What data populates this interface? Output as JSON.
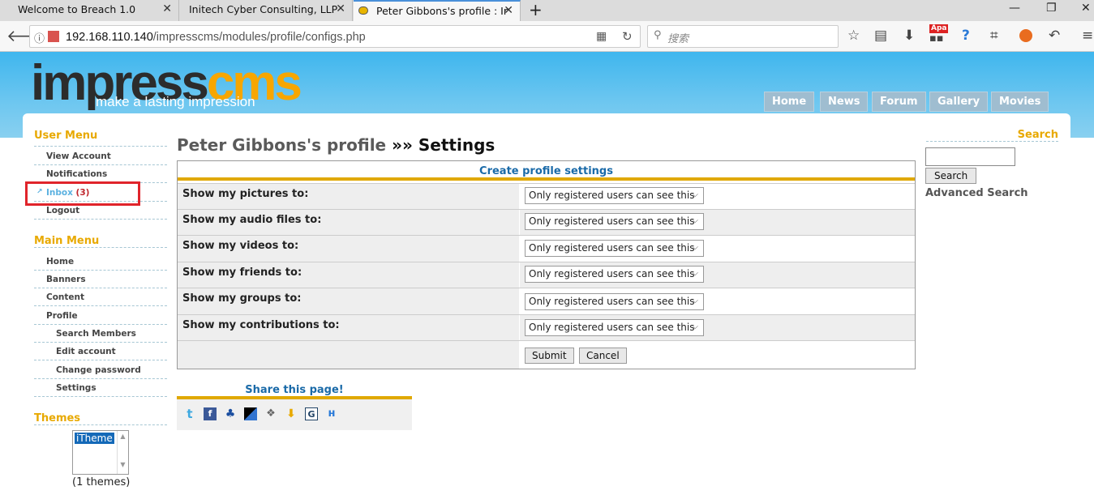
{
  "browser": {
    "tabs": [
      {
        "label": "Welcome to Breach 1.0"
      },
      {
        "label": "Initech Cyber Consulting, LLP"
      },
      {
        "label": "Peter Gibbons's profile : Ir"
      }
    ],
    "url_host": "192.168.110.140",
    "url_path": "/impresscms/modules/profile/configs.php",
    "search_placeholder": "搜索",
    "addon_badge": "Apa"
  },
  "site": {
    "logo_part1": "impress",
    "logo_part2": "cms",
    "tagline": "make a lasting impression",
    "nav": [
      "Home",
      "News",
      "Forum",
      "Gallery",
      "Movies"
    ]
  },
  "user_menu": {
    "title": "User Menu",
    "items": [
      "View Account",
      "Notifications",
      "Inbox",
      "Logout"
    ],
    "inbox_count": "(3)"
  },
  "main_menu": {
    "title": "Main Menu",
    "items": [
      "Home",
      "Banners",
      "Content",
      "Profile"
    ],
    "sub_items": [
      "Search Members",
      "Edit account",
      "Change password",
      "Settings"
    ]
  },
  "themes": {
    "title": "Themes",
    "option": "iTheme",
    "count": "(1 themes)"
  },
  "page": {
    "title_part1": "Peter Gibbons's profile",
    "separator": "»»",
    "title_part2": "Settings"
  },
  "form": {
    "caption": "Create profile settings",
    "rows": [
      {
        "label": "Show my pictures to:",
        "value": "Only registered users can see this"
      },
      {
        "label": "Show my audio files to:",
        "value": "Only registered users can see this"
      },
      {
        "label": "Show my videos to:",
        "value": "Only registered users can see this"
      },
      {
        "label": "Show my friends to:",
        "value": "Only registered users can see this"
      },
      {
        "label": "Show my groups to:",
        "value": "Only registered users can see this"
      },
      {
        "label": "Show my contributions to:",
        "value": "Only registered users can see this"
      }
    ],
    "submit": "Submit",
    "cancel": "Cancel"
  },
  "share": {
    "title": "Share this page!"
  },
  "search_block": {
    "title": "Search",
    "button": "Search",
    "advanced": "Advanced Search"
  }
}
